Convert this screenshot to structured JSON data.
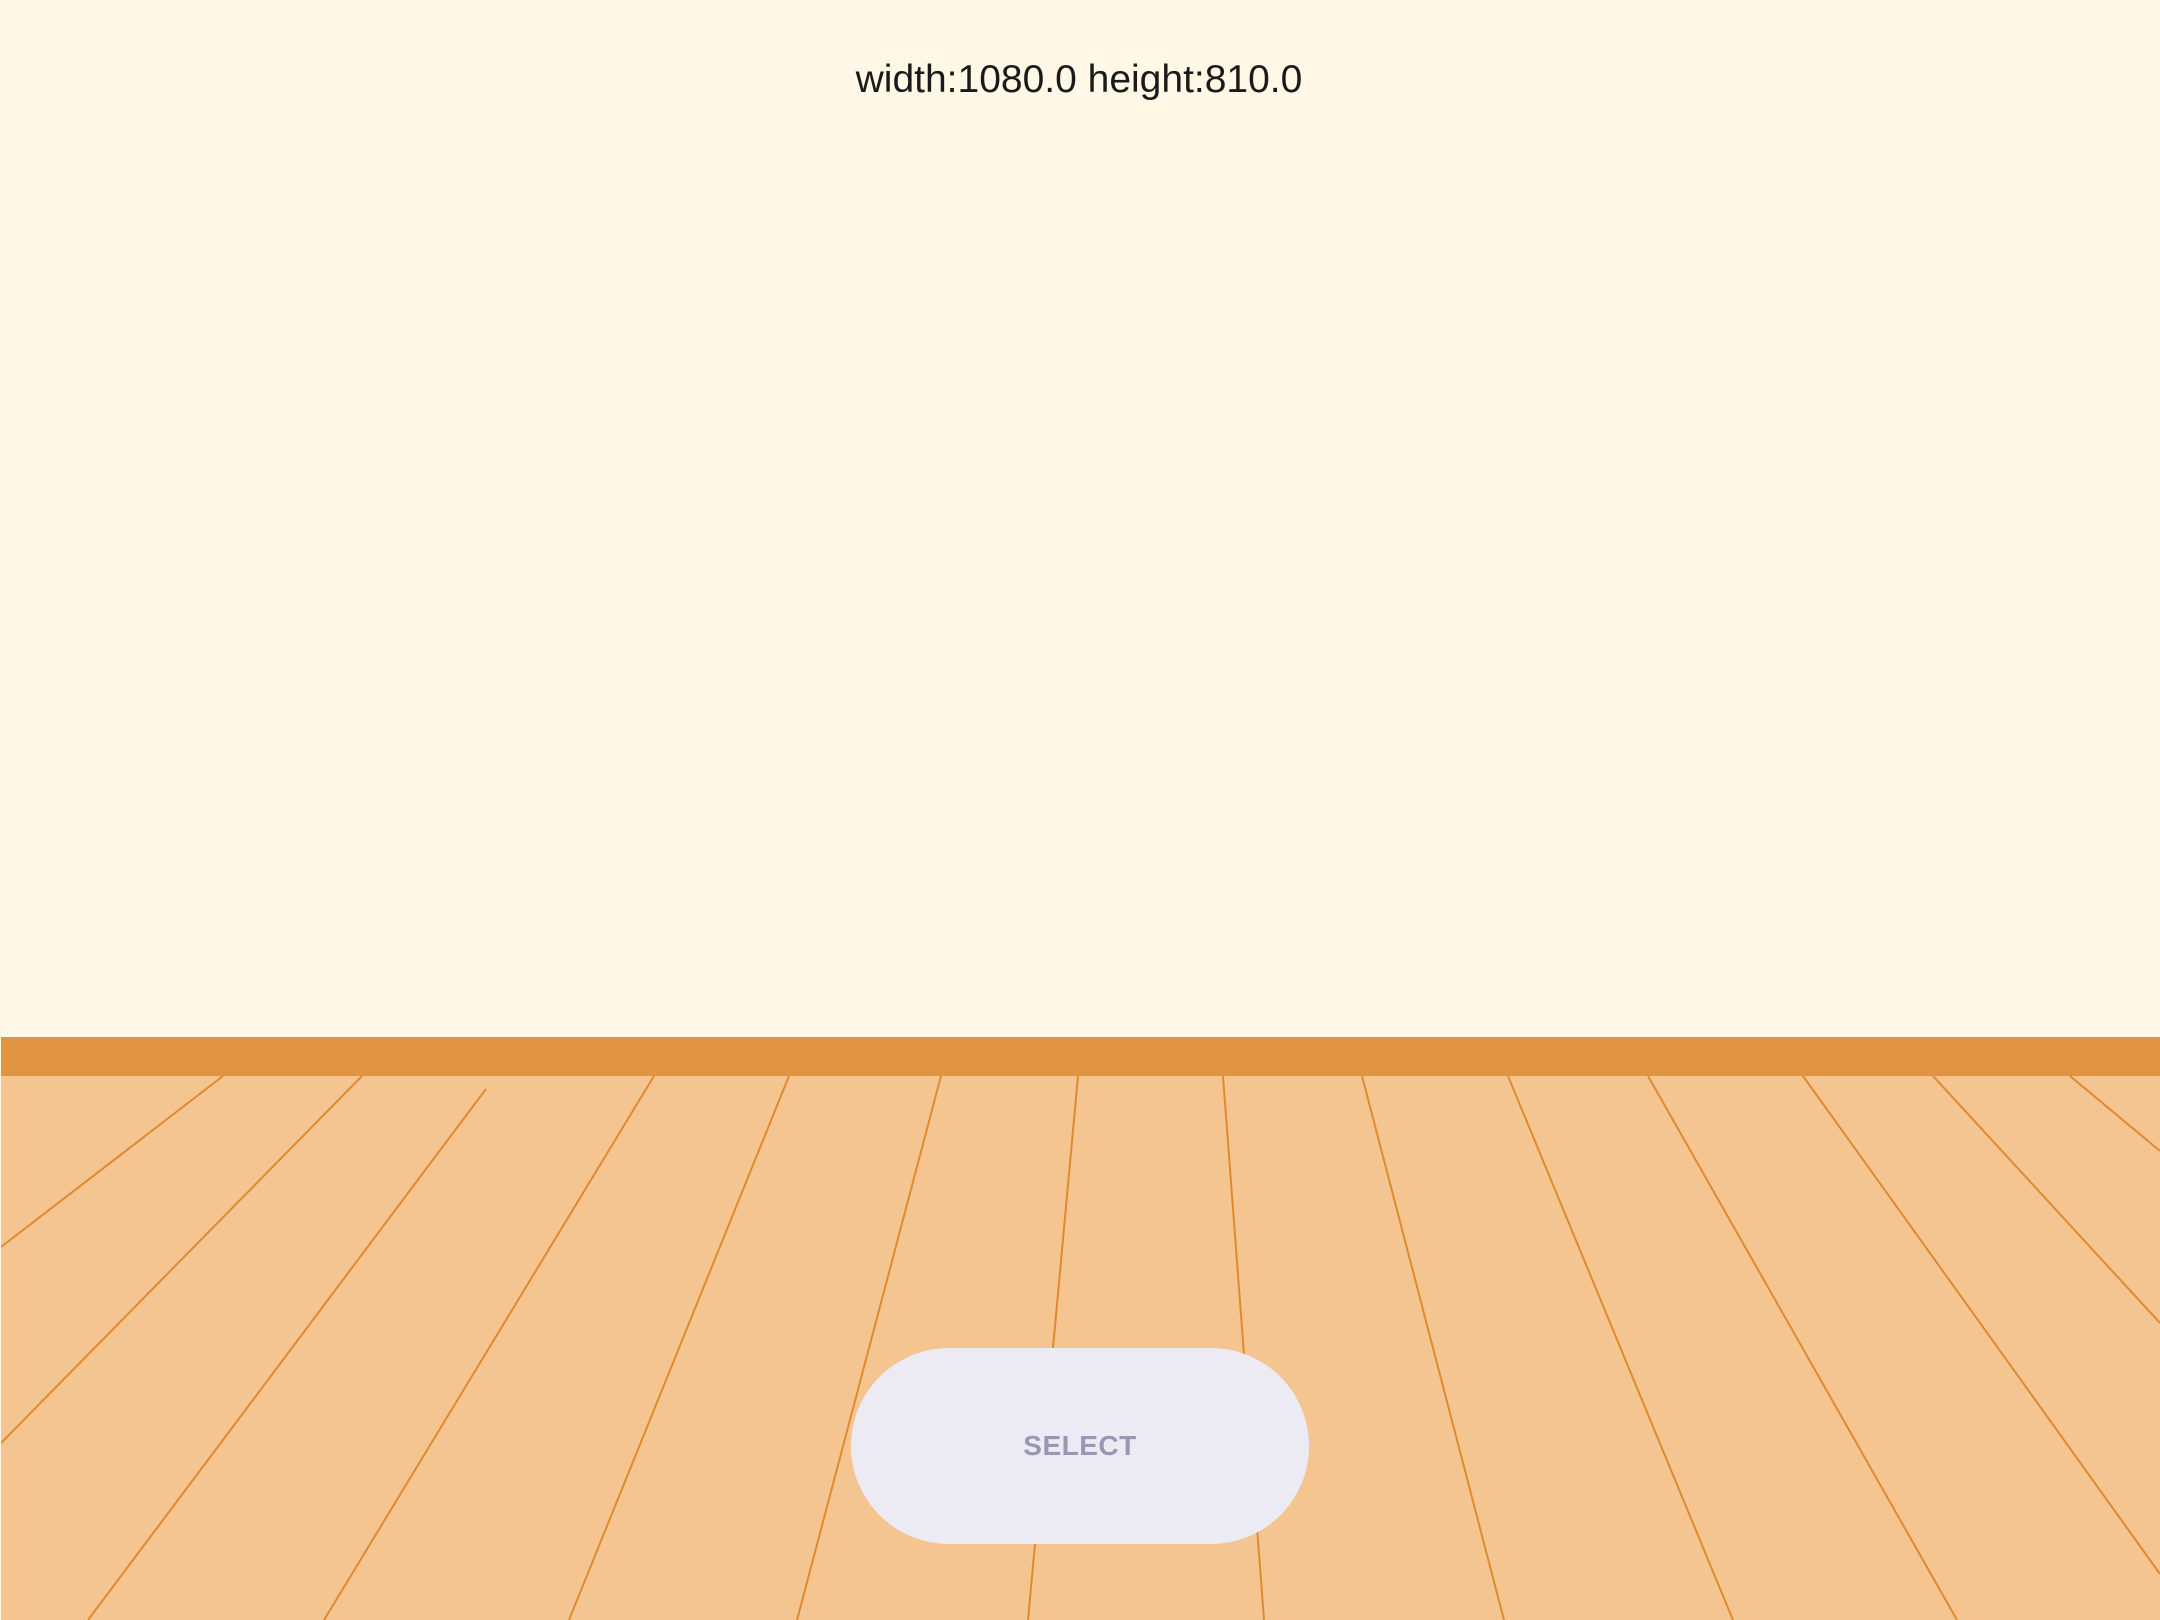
{
  "header": {
    "size_label": "width:1080.0 height:810.0"
  },
  "controls": {
    "select_label": "SELECT"
  },
  "colors": {
    "wall": "#fff8e6",
    "baseboard": "#e09341",
    "floor": "#f5c591",
    "floor_lines": "#e08a30",
    "button_bg": "#eceaf3",
    "button_text": "#9a97b5"
  }
}
